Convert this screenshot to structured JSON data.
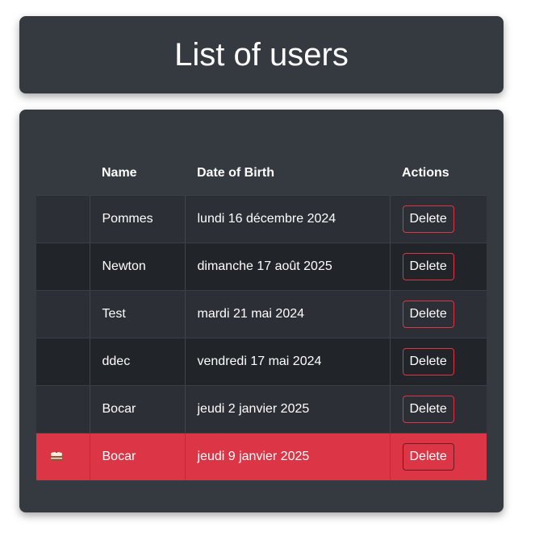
{
  "header": {
    "title": "List of users"
  },
  "table": {
    "columns": [
      "",
      "Name",
      "Date of Birth",
      "Actions"
    ],
    "rows": [
      {
        "icon": "",
        "name": "Pommes",
        "dob": "lundi 16 décembre 2024",
        "action": "Delete"
      },
      {
        "icon": "",
        "name": "Newton",
        "dob": "dimanche 17 août 2025",
        "action": "Delete"
      },
      {
        "icon": "",
        "name": "Test",
        "dob": "mardi 21 mai 2024",
        "action": "Delete"
      },
      {
        "icon": "",
        "name": "ddec",
        "dob": "vendredi 17 mai 2024",
        "action": "Delete"
      },
      {
        "icon": "",
        "name": "Bocar",
        "dob": "jeudi 2 janvier 2025",
        "action": "Delete"
      },
      {
        "icon": "cake-icon",
        "name": "Bocar",
        "dob": "jeudi 9 janvier 2025",
        "action": "Delete"
      }
    ]
  },
  "colors": {
    "card": "#343a40",
    "highlight": "#dc3545",
    "row_odd": "#2c3036",
    "row_even": "#212428"
  }
}
